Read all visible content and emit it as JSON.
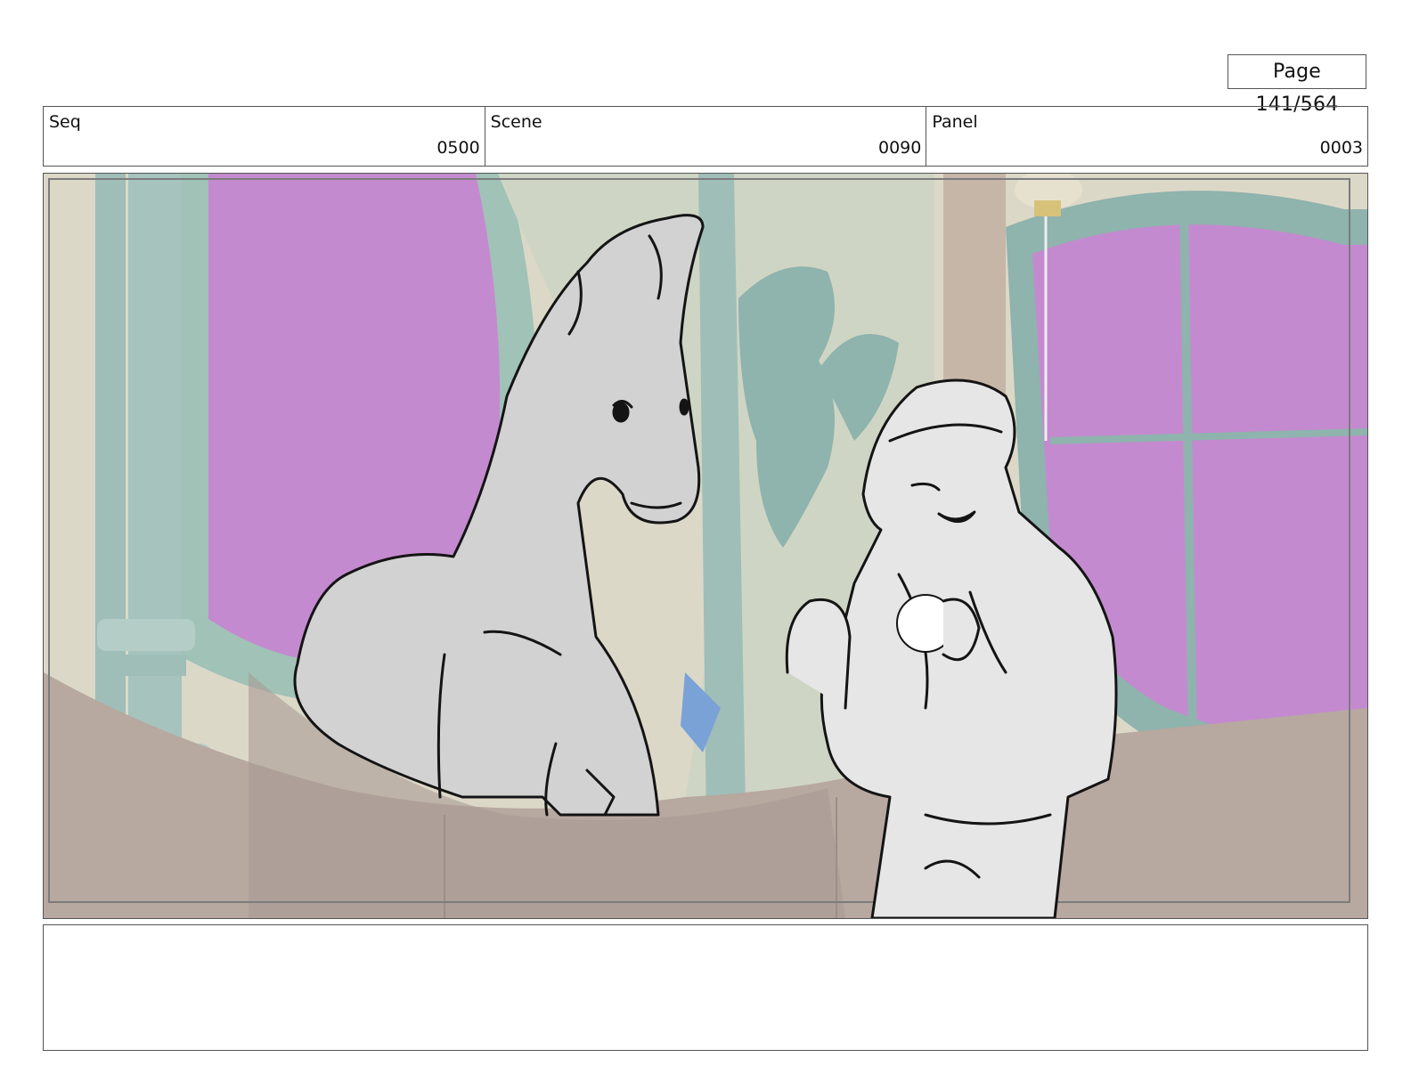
{
  "page": {
    "label": "Page 141/564"
  },
  "header": {
    "seq": {
      "label": "Seq",
      "value": "0500"
    },
    "scene": {
      "label": "Scene",
      "value": "0090"
    },
    "panel": {
      "label": "Panel",
      "value": "0003"
    }
  },
  "frame": {
    "description_colors": {
      "window_magenta": "#c48ad0",
      "teal_frame": "#8fb3ad",
      "wall_beige": "#ddd8c6",
      "counter_taupe": "#b5a69e",
      "sketch_fill": "#d2d2d2",
      "sketch_line": "#141414"
    }
  },
  "notes": {
    "text": ""
  }
}
